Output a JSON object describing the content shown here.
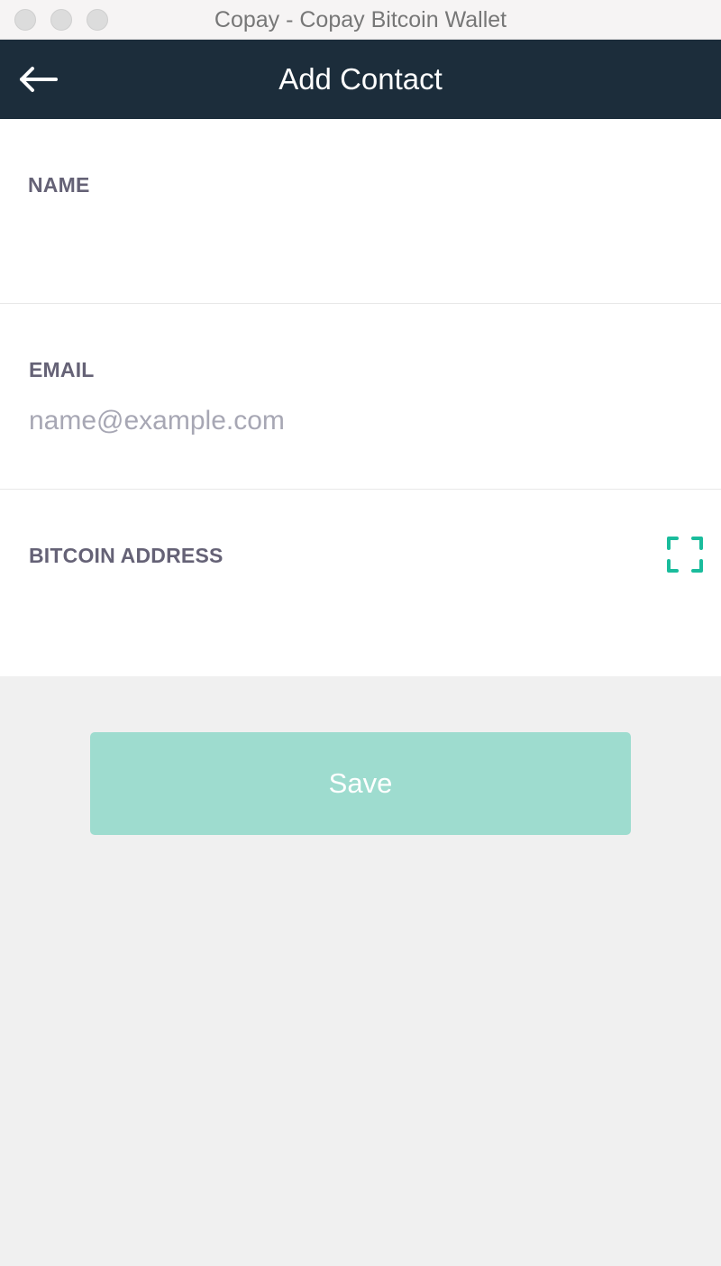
{
  "window": {
    "title": "Copay - Copay Bitcoin Wallet"
  },
  "header": {
    "title": "Add Contact",
    "back_icon": "arrow-left-icon"
  },
  "form": {
    "name": {
      "label": "NAME",
      "value": "",
      "placeholder": ""
    },
    "email": {
      "label": "EMAIL",
      "value": "",
      "placeholder": "name@example.com"
    },
    "address": {
      "label": "BITCOIN ADDRESS",
      "value": "",
      "placeholder": "",
      "scan_icon": "qr-scan-icon"
    }
  },
  "actions": {
    "save_label": "Save"
  },
  "colors": {
    "header_bg": "#1c2d3b",
    "accent": "#1abc9c",
    "save_bg_disabled": "#9edccf",
    "label": "#656276",
    "placeholder": "#a7a7b4"
  }
}
